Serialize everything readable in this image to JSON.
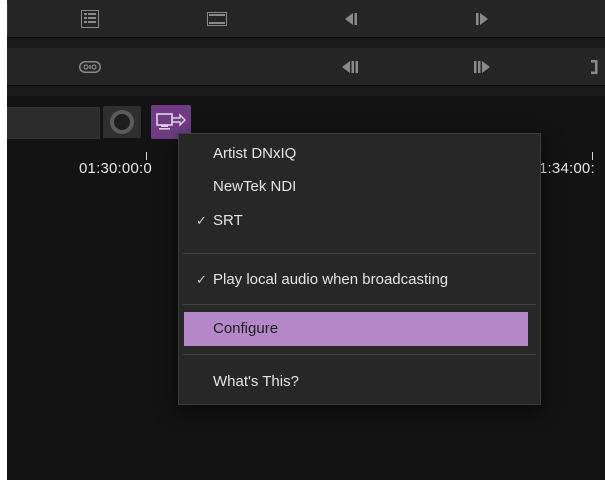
{
  "toolbar": {
    "row1": [
      "list-icon",
      "filmstrip-icon",
      "step-back-icon",
      "step-forward-icon"
    ],
    "row2": [
      "loop-icon",
      "prev-edit-icon",
      "next-edit-icon",
      "mark-out-icon"
    ]
  },
  "broadcast": {
    "button_icon": "broadcast-output-icon",
    "accent": "#6f3c84"
  },
  "timeline": {
    "left_timecode": "01:30:00:0",
    "right_timecode": "1:34:00:"
  },
  "menu": {
    "items": [
      {
        "label": "Artist DNxIQ",
        "checked": false
      },
      {
        "label": "NewTek NDI",
        "checked": false
      },
      {
        "label": "SRT",
        "checked": true
      },
      {
        "label": "Play local audio when broadcasting",
        "checked": true
      },
      {
        "label": "Configure",
        "checked": false,
        "highlighted": true
      },
      {
        "label": "What's This?",
        "checked": false
      }
    ],
    "check_glyph": "✓",
    "highlight_color": "#b487c8"
  }
}
